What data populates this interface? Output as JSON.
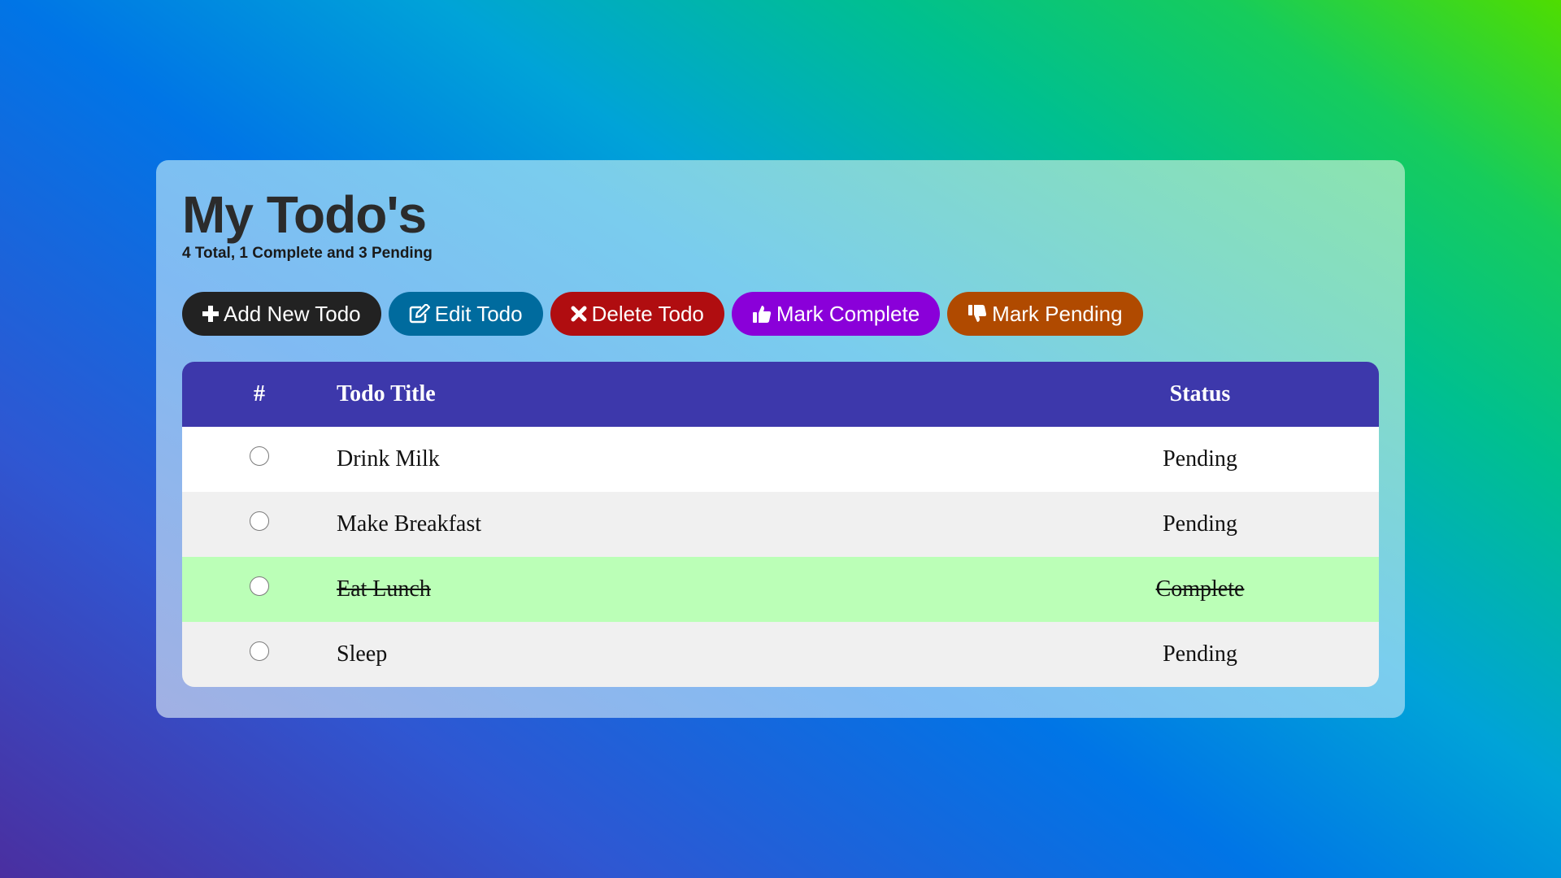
{
  "header": {
    "title": "My Todo's",
    "summary": "4 Total, 1 Complete and 3 Pending"
  },
  "toolbar": {
    "add_label": "Add New Todo",
    "edit_label": "Edit Todo",
    "delete_label": "Delete Todo",
    "complete_label": "Mark Complete",
    "pending_label": "Mark Pending",
    "icons": [
      "plus-icon",
      "edit-icon",
      "close-icon",
      "thumbs-up-icon",
      "thumbs-down-icon"
    ],
    "colors": {
      "add": "#222222",
      "edit": "#006b9e",
      "delete": "#b00d10",
      "complete": "#8a00d9",
      "pending": "#b04a00"
    }
  },
  "table": {
    "columns": [
      "#",
      "Todo Title",
      "Status"
    ],
    "header_color": "#3d38ab",
    "complete_row_color": "#bbffb7",
    "rows": [
      {
        "title": "Drink Milk",
        "status": "Pending",
        "selected": false
      },
      {
        "title": "Make Breakfast",
        "status": "Pending",
        "selected": false
      },
      {
        "title": "Eat Lunch",
        "status": "Complete",
        "selected": false
      },
      {
        "title": "Sleep",
        "status": "Pending",
        "selected": false
      }
    ]
  }
}
